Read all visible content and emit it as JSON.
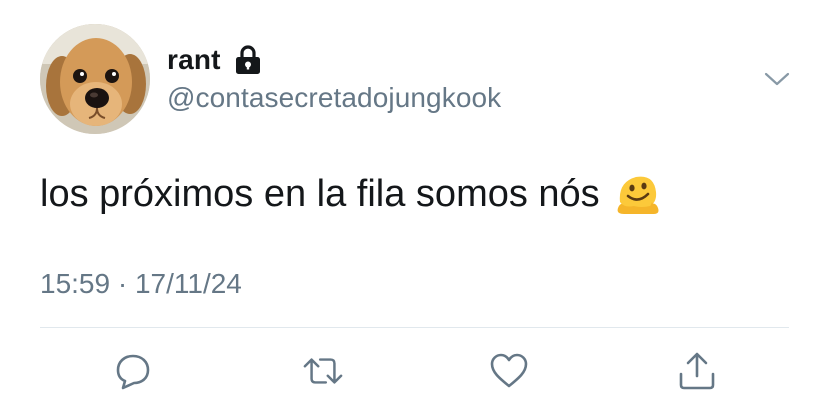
{
  "user": {
    "display_name": "rant",
    "handle": "@contasecretadojungkook",
    "avatar_icon": "puppy-avatar",
    "protected_icon": "lock-icon"
  },
  "tweet": {
    "text": "los próximos en la fila somos nós",
    "emoji": "melting-face-emoji"
  },
  "meta": {
    "timestamp": "15:59 · 17/11/24"
  },
  "actions": [
    {
      "name": "reply",
      "icon": "reply-icon"
    },
    {
      "name": "retweet",
      "icon": "retweet-icon"
    },
    {
      "name": "like",
      "icon": "heart-icon"
    },
    {
      "name": "share",
      "icon": "share-icon"
    }
  ],
  "colors": {
    "text_primary": "#14171a",
    "text_secondary": "#657786",
    "divider": "#e1e8ed",
    "icon": "#657786"
  }
}
